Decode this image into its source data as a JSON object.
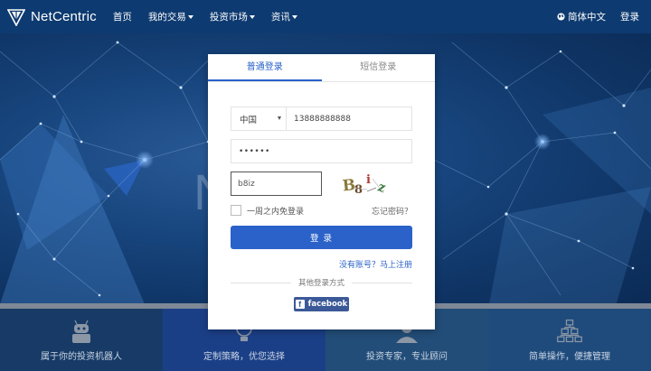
{
  "header": {
    "brand": "NetCentric",
    "nav": [
      {
        "label": "首页",
        "dropdown": false
      },
      {
        "label": "我的交易",
        "dropdown": true
      },
      {
        "label": "投资市场",
        "dropdown": true
      },
      {
        "label": "资讯",
        "dropdown": true
      }
    ],
    "language": "简体中文",
    "login": "登录"
  },
  "hero": {
    "big_letter": "N"
  },
  "login_card": {
    "tabs": [
      {
        "label": "普通登录",
        "active": true
      },
      {
        "label": "短信登录",
        "active": false
      }
    ],
    "country": "中国",
    "phone": "13888888888",
    "password_mask": "••••••",
    "captcha_input": "b8iz",
    "captcha_chars": [
      "B",
      "8",
      "i",
      "z"
    ],
    "remember_label": "一周之内免登录",
    "forgot_label": "忘记密码？",
    "submit_label": "登 录",
    "register_label": "没有账号？马上注册",
    "other_login_label": "其他登录方式",
    "facebook_label": "facebook"
  },
  "features": [
    {
      "label": "属于你的投资机器人",
      "icon": "robot-icon"
    },
    {
      "label": "定制策略，优您选择",
      "icon": "lightbulb-icon"
    },
    {
      "label": "投资专家，专业顾问",
      "icon": "expert-icon"
    },
    {
      "label": "简单操作，便捷管理",
      "icon": "sitemap-icon"
    }
  ],
  "colors": {
    "header_bg": "#0d3a70",
    "accent": "#2a62c9",
    "facebook": "#3b5998"
  }
}
